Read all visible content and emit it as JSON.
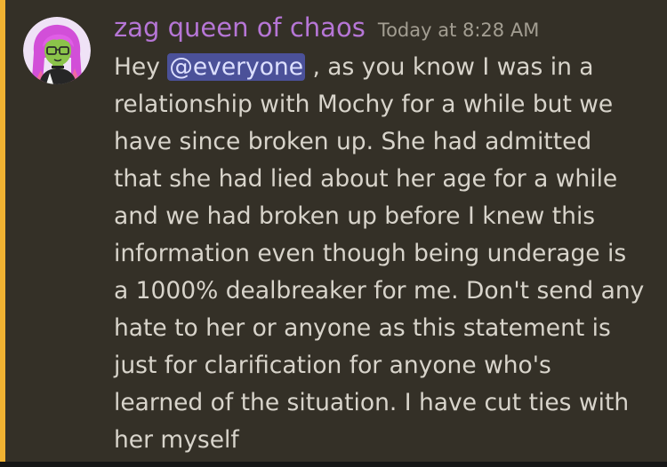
{
  "colors": {
    "accent_bar": "#f0b232",
    "username": "#b676d6",
    "mention_bg": "#4b5199",
    "mention_text": "#dde0ff"
  },
  "message": {
    "avatar_icon": "avatar-anime-girl-pink-hair-icon",
    "author": "zag queen of chaos",
    "timestamp": "Today at 8:28 AM",
    "first_line": {
      "prefix": "Hey ",
      "mention": "@everyone",
      "suffix": " , as you know I was in a"
    },
    "lines": [
      "relationship with Mochy for a while but we",
      "have since broken up. She had admitted",
      "that she had lied about her age for a while",
      "and we had broken up before I knew this",
      "information even though being underage is",
      "a 1000% dealbreaker for me. Don't send any",
      "hate to her or anyone as this statement is",
      "just for clarification for anyone who's",
      "learned of the situation. I have cut ties with",
      "her myself"
    ]
  }
}
